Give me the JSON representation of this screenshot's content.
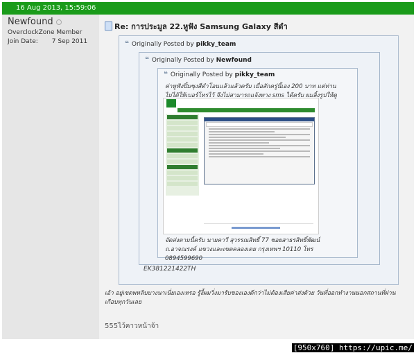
{
  "post": {
    "date": "16 Aug 2013, 15:59:06",
    "title": "Re: การประมูล 22.หูฟัง Samsung Galaxy สีดำ"
  },
  "user": {
    "name": "Newfound",
    "title": "OverclockZone Member",
    "join_label": "Join Date:",
    "join_value": "7 Sep 2011"
  },
  "quotes": {
    "outer": {
      "prefix": "Originally Posted by",
      "author": "pikky_team"
    },
    "middle": {
      "prefix": "Originally Posted by",
      "author": "Newfound"
    },
    "inner": {
      "prefix": "Originally Posted by",
      "author": "pikky_team",
      "text1": "ค่าหูฟังปิ้มซุงสีดำโอนแล้วแล้วครับ เมื่อสักครู่นี้เอง 200 บาท แต่ท่านไม่ได้ให้เบอร์โทรไว้ จึงไม่สามารถแจ้งทาง sms ได้ครับ ผมลิ้งรูปให้ดูละกัน",
      "text2": "จัดส่งตามนี้ครับ นายคาวี สุวรรณสิทธิ์ 77 ซอยสาธรสิทธิ์พัฒน์ ถ.อาจณรงค์ แขวงและเขตคลองเตย กรุงเทพฯ 10110 โทร 0894599690"
    },
    "tracking": "EK381221422TH",
    "reply": "เอ้า อยู่เขตพหลิบบางนาเนี่ยเองเหรอ รู้งี้ผมวิ่งมารับของเองดีกว่าไม่ต้องเสียค่าส่งด้วย วันที่ออกทำงานนอกสถานที่ผ่านเกือบทุกวันเลย"
  },
  "signature": "555ไว้คาวหน้าจ้า",
  "watermark": "[950x760] https://upic.me/",
  "colors": {
    "topbar": "#1a9b1a",
    "quote_border": "#a7b8cc"
  },
  "icons": [
    "status-offline-icon",
    "post-document-icon",
    "quote-icon"
  ]
}
